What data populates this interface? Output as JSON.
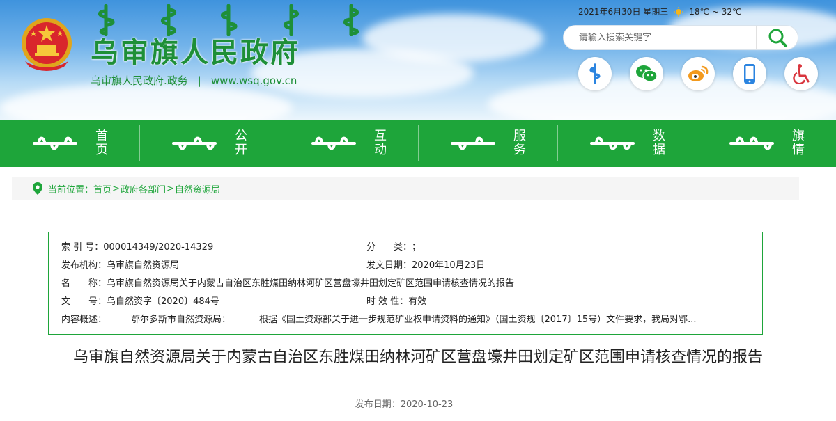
{
  "header": {
    "site_title": "乌审旗人民政府",
    "site_sub_name": "乌审旗人民政府.政务",
    "site_sub_sep": "|",
    "site_url": "www.wsq.gov.cn",
    "date": "2021年6月30日 星期三",
    "weather": "18℃ ~ 32℃",
    "search_placeholder": "请输入搜索关键字",
    "quick_icons": [
      "mongolian-script-icon",
      "wechat-icon",
      "weibo-icon",
      "mobile-icon",
      "accessibility-icon"
    ],
    "colors": {
      "brand_green": "#1ea53a",
      "weibo_orange": "#f39a1e",
      "mobile_blue": "#2b84e0",
      "access_red": "#d9363e"
    }
  },
  "nav": {
    "items": [
      {
        "label_top": "首",
        "label_bottom": "页"
      },
      {
        "label_top": "公",
        "label_bottom": "开"
      },
      {
        "label_top": "互",
        "label_bottom": "动"
      },
      {
        "label_top": "服",
        "label_bottom": "务"
      },
      {
        "label_top": "数",
        "label_bottom": "据"
      },
      {
        "label_top": "旗",
        "label_bottom": "情"
      }
    ]
  },
  "breadcrumb": {
    "prefix": "当前位置：",
    "items": [
      "首页",
      "政府各部门",
      "自然资源局"
    ],
    "sep": ">"
  },
  "info": {
    "index_label": "索 引 号：",
    "index_value": "000014349/2020-14329",
    "category_label": "分　　类：",
    "category_value": "；",
    "org_label": "发布机构：",
    "org_value": "乌审旗自然资源局",
    "date_label": "发文日期：",
    "date_value": "2020年10月23日",
    "name_label": "名　　称：",
    "name_value": "乌审旗自然资源局关于内蒙古自治区东胜煤田纳林河矿区营盘壕井田划定矿区范围申请核查情况的报告",
    "doc_label": "文　　号：",
    "doc_value": "乌自然资字〔2020〕484号",
    "valid_label": "时 效 性：",
    "valid_value": "有效",
    "summary_label": "内容概述：",
    "summary_addressee": "鄂尔多斯市自然资源局：",
    "summary_text": "根据《国土资源部关于进一步规范矿业权申请资料的通知》（国土资规〔2017〕15号）文件要求，我局对鄂..."
  },
  "article": {
    "title": "乌审旗自然资源局关于内蒙古自治区东胜煤田纳林河矿区营盘壕井田划定矿区范围申请核查情况的报告",
    "pub_date_label": "发布日期：",
    "pub_date_value": "2020-10-23"
  }
}
